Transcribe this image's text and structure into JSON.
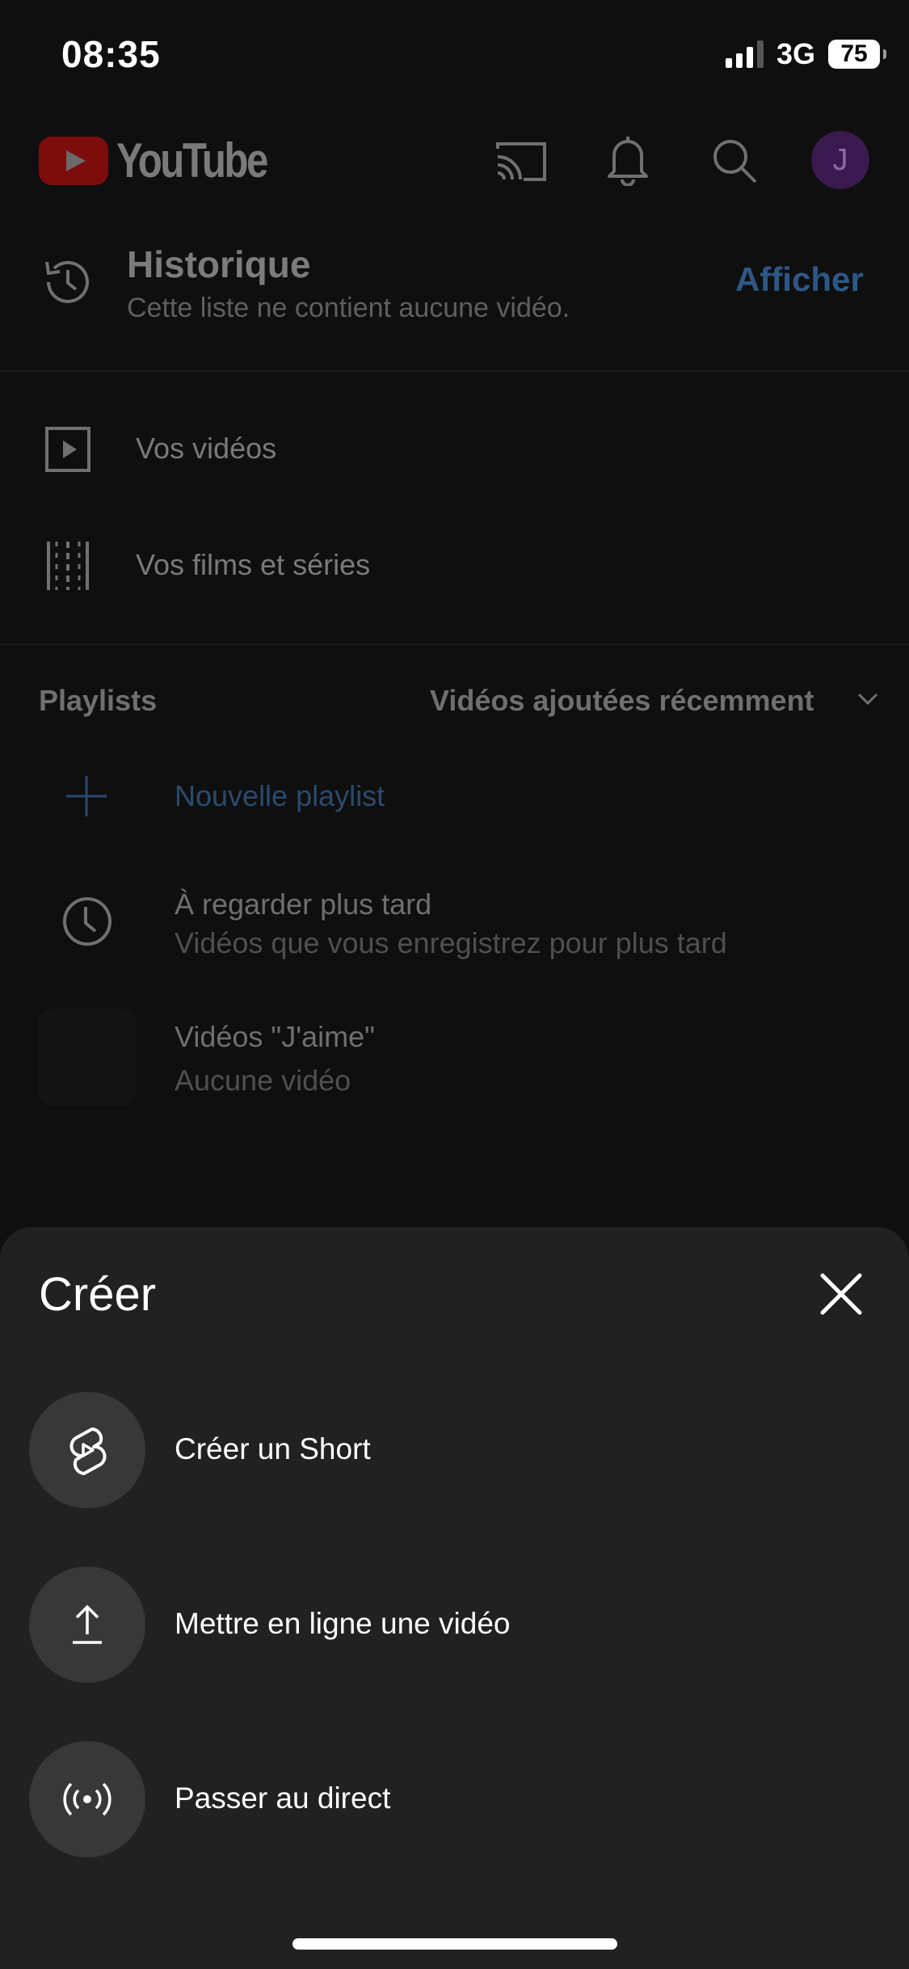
{
  "status_bar": {
    "time": "08:35",
    "network": "3G",
    "battery": "75"
  },
  "header": {
    "logo_text": "YouTube",
    "avatar_initial": "J"
  },
  "history": {
    "title": "Historique",
    "subtitle": "Cette liste ne contient aucune vidéo.",
    "action": "Afficher"
  },
  "library_items": [
    {
      "label": "Vos vidéos",
      "icon": "play-square-icon"
    },
    {
      "label": "Vos films et séries",
      "icon": "film-strip-icon"
    }
  ],
  "playlists": {
    "heading": "Playlists",
    "sort_label": "Vidéos ajoutées récemment",
    "new_playlist": "Nouvelle playlist",
    "items": [
      {
        "title": "À regarder plus tard",
        "subtitle": "Vidéos que vous enregistrez pour plus tard",
        "icon": "clock-icon"
      },
      {
        "title": "Vidéos \"J'aime\"",
        "subtitle": "Aucune vidéo"
      }
    ]
  },
  "create_sheet": {
    "title": "Créer",
    "options": [
      {
        "label": "Créer un Short",
        "icon": "shorts-icon"
      },
      {
        "label": "Mettre en ligne une vidéo",
        "icon": "upload-icon"
      },
      {
        "label": "Passer au direct",
        "icon": "live-broadcast-icon"
      }
    ]
  },
  "colors": {
    "background": "#0f0f0f",
    "sheet": "#212121",
    "accent_dimmed": "#2e5786",
    "logo_red": "#ff0000"
  }
}
